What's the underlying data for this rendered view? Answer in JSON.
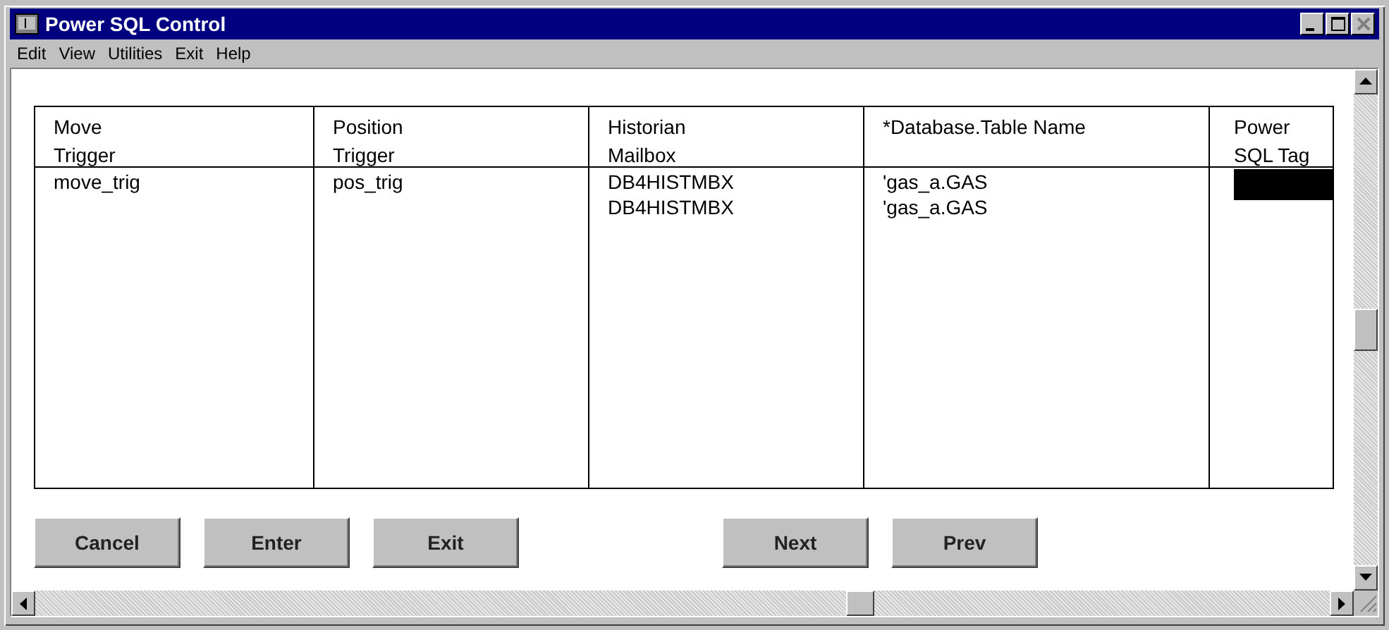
{
  "window": {
    "title": "Power SQL Control"
  },
  "menu": [
    "Edit",
    "View",
    "Utilities",
    "Exit",
    "Help"
  ],
  "table": {
    "columns": [
      "Move\nTrigger",
      "Position\nTrigger",
      "Historian\nMailbox",
      "*Database.Table Name",
      "Power\nSQL Tag"
    ],
    "rows": [
      {
        "cells": [
          {
            "text": "move_trig",
            "selected": false
          },
          {
            "text": "pos_trig",
            "selected": false
          },
          {
            "text": "DB4HISTMBX",
            "selected": false
          },
          {
            "text": "'gas_a.GAS",
            "selected": false
          },
          {
            "selected": true
          }
        ]
      },
      {
        "cells": [
          null,
          null,
          {
            "text": "DB4HISTMBX",
            "selected": false
          },
          {
            "text": "'gas_a.GAS",
            "selected": false
          },
          null
        ]
      }
    ]
  },
  "buttons_left": [
    "Cancel",
    "Enter",
    "Exit"
  ],
  "buttons_right": [
    "Next",
    "Prev"
  ]
}
